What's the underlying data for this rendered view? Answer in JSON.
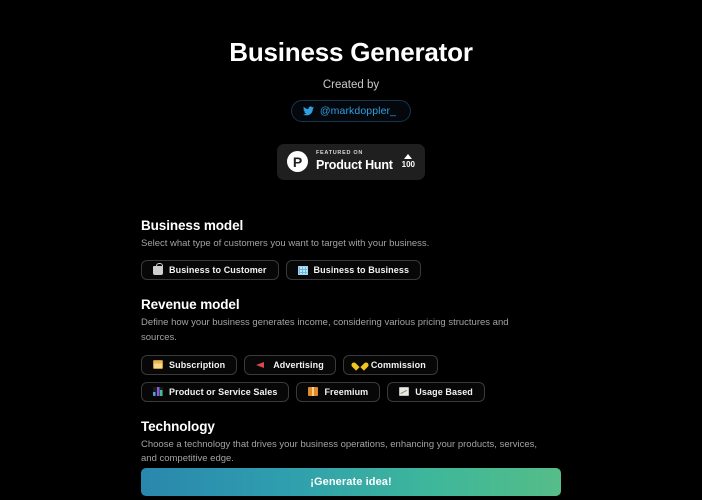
{
  "header": {
    "title": "Business Generator",
    "created_by_label": "Created by",
    "twitter_handle": "@markdoppler_",
    "twitter_icon": "twitter-bird-icon"
  },
  "product_hunt": {
    "logo_letter": "P",
    "featured_label": "FEATURED ON",
    "name": "Product Hunt",
    "upvote_count": "100",
    "upvote_icon": "caret-up-icon"
  },
  "sections": [
    {
      "id": "business-model",
      "title": "Business model",
      "description": "Select what type of customers you want to target with your business.",
      "options": [
        {
          "label": "Business to Customer",
          "icon": "shopping-bag-icon",
          "icon_class": "ico-bag"
        },
        {
          "label": "Business to Business",
          "icon": "office-building-icon",
          "icon_class": "ico-building"
        }
      ]
    },
    {
      "id": "revenue-model",
      "title": "Revenue model",
      "description": "Define how your business generates income, considering various pricing structures and sources.",
      "options": [
        {
          "label": "Subscription",
          "icon": "credit-card-icon",
          "icon_class": "ico-card"
        },
        {
          "label": "Advertising",
          "icon": "megaphone-icon",
          "icon_class": "ico-mega"
        },
        {
          "label": "Commission",
          "icon": "yellow-heart-icon",
          "icon_class": "ico-heart"
        },
        {
          "label": "Product or Service Sales",
          "icon": "bar-chart-icon",
          "icon_class": "ico-chart"
        },
        {
          "label": "Freemium",
          "icon": "gift-icon",
          "icon_class": "ico-gift"
        },
        {
          "label": "Usage Based",
          "icon": "line-chart-icon",
          "icon_class": "ico-graph"
        }
      ]
    },
    {
      "id": "technology",
      "title": "Technology",
      "description": "Choose a technology that drives your business operations, enhancing your products, services, and competitive edge.",
      "options": []
    }
  ],
  "technology_partial_widths": [
    110,
    90,
    105,
    95
  ],
  "cta": {
    "label": "¡Generate idea!",
    "gradient_start": "#2a87ad",
    "gradient_end": "#55bd88"
  },
  "theme": {
    "background": "#000000",
    "accent_blue": "#2f9fe0",
    "chip_border": "#3a3a3a"
  }
}
